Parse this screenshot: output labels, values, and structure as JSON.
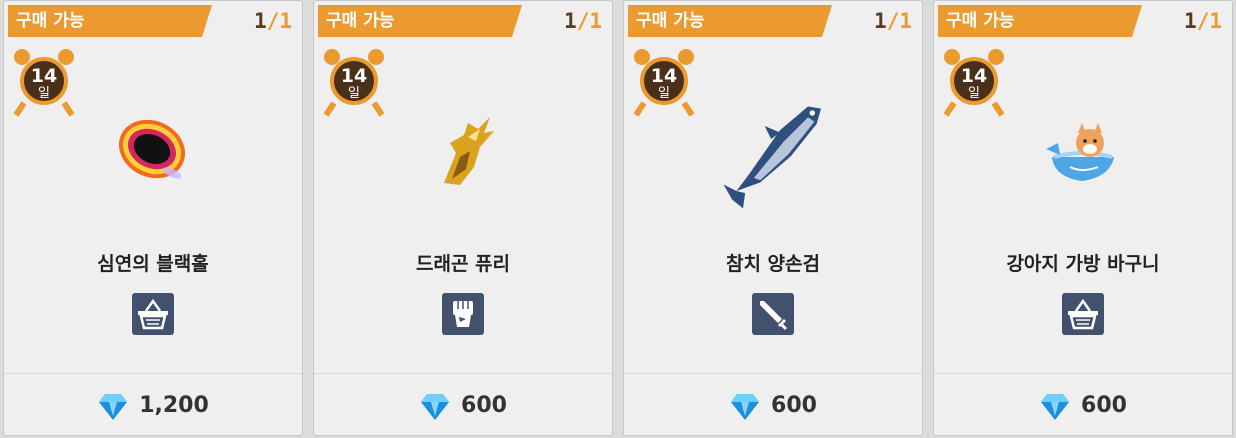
{
  "cards": [
    {
      "tag": "구매 가능",
      "count_current": "1",
      "count_sep": "/",
      "count_max": "1",
      "days": "14",
      "days_unit": "일",
      "name": "심연의 블랙홀",
      "category_icon": "basket-icon",
      "price": "1,200",
      "currency_icon": "diamond-icon",
      "item_icon": "black-hole-icon"
    },
    {
      "tag": "구매 가능",
      "count_current": "1",
      "count_sep": "/",
      "count_max": "1",
      "days": "14",
      "days_unit": "일",
      "name": "드래곤 퓨리",
      "category_icon": "fist-icon",
      "price": "600",
      "currency_icon": "diamond-icon",
      "item_icon": "dragon-claw-icon"
    },
    {
      "tag": "구매 가능",
      "count_current": "1",
      "count_sep": "/",
      "count_max": "1",
      "days": "14",
      "days_unit": "일",
      "name": "참치 양손검",
      "category_icon": "sword-icon",
      "price": "600",
      "currency_icon": "diamond-icon",
      "item_icon": "tuna-icon"
    },
    {
      "tag": "구매 가능",
      "count_current": "1",
      "count_sep": "/",
      "count_max": "1",
      "days": "14",
      "days_unit": "일",
      "name": "강아지 가방 바구니",
      "category_icon": "basket-icon",
      "price": "600",
      "currency_icon": "diamond-icon",
      "item_icon": "dog-basket-icon"
    }
  ],
  "colors": {
    "tag_bg": "#eb9a2f",
    "timer_face": "#4a2f1a",
    "category_bg": "#42526e",
    "gem": "#1a8fe0"
  }
}
